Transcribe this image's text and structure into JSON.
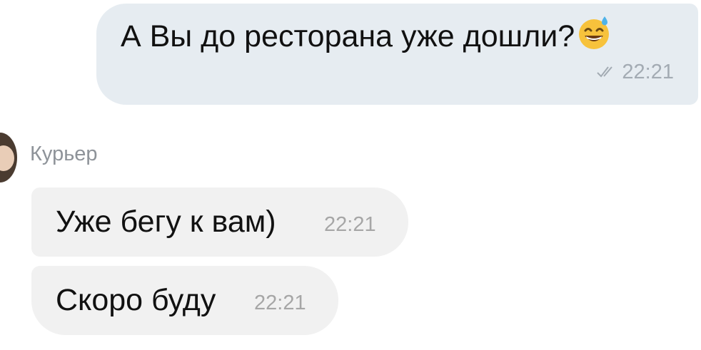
{
  "outgoing": {
    "text": "А Вы до ресторана уже дошли?",
    "emoji_icon": "grinning-face-with-sweat-icon",
    "time": "22:21",
    "status_icon": "double-check-icon"
  },
  "incoming": {
    "sender": "Курьер",
    "messages": [
      {
        "text": "Уже бегу к вам)",
        "time": "22:21"
      },
      {
        "text": "Скоро буду",
        "time": "22:21"
      }
    ]
  },
  "colors": {
    "outgoing_bubble": "#e6ecf1",
    "incoming_bubble": "#f1f1f1",
    "timestamp": "#a3abb3",
    "sender": "#8e9399"
  }
}
